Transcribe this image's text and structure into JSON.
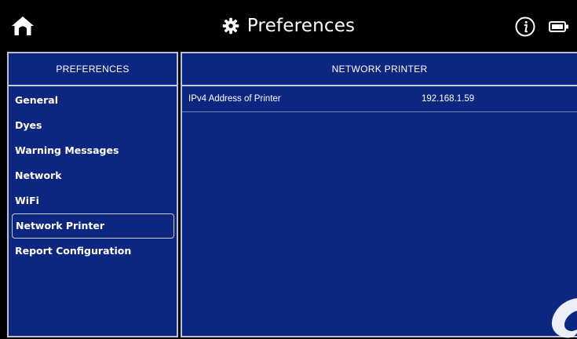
{
  "header": {
    "title": "Preferences",
    "home_icon": "home-icon",
    "settings_icon": "gear-icon",
    "info_icon": "info-icon",
    "battery_icon": "battery-icon"
  },
  "left_panel": {
    "heading": "PREFERENCES",
    "items": [
      {
        "label": "General"
      },
      {
        "label": "Dyes"
      },
      {
        "label": "Warning Messages"
      },
      {
        "label": "Network"
      },
      {
        "label": "WiFi"
      },
      {
        "label": "Network Printer",
        "selected": true
      },
      {
        "label": "Report Configuration"
      }
    ]
  },
  "right_panel": {
    "heading": "NETWORK PRINTER",
    "rows": [
      {
        "label": "IPv4 Address of Printer",
        "value": "192.168.1.59"
      }
    ]
  },
  "colors": {
    "panel_bg": "#0d2680",
    "bar_bg": "#000000",
    "border": "#b9c1d4",
    "text": "#ffffff"
  }
}
